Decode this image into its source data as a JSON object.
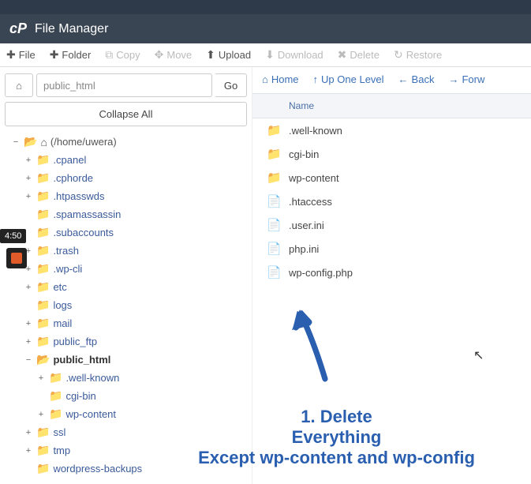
{
  "header": {
    "logo": "cP",
    "title": "File Manager"
  },
  "toolbar": {
    "file": "File",
    "folder": "Folder",
    "copy": "Copy",
    "move": "Move",
    "upload": "Upload",
    "download": "Download",
    "delete": "Delete",
    "restore": "Restore"
  },
  "address": {
    "path": "public_html",
    "go": "Go"
  },
  "collapse_all": "Collapse All",
  "tree": {
    "root": "(/home/uwera)",
    "items": [
      {
        "label": ".cpanel",
        "toggle": "+",
        "icon": "folder",
        "indent": 1
      },
      {
        "label": ".cphorde",
        "toggle": "+",
        "icon": "folder",
        "indent": 1
      },
      {
        "label": ".htpasswds",
        "toggle": "+",
        "icon": "folder",
        "indent": 1
      },
      {
        "label": ".spamassassin",
        "toggle": "",
        "icon": "folder",
        "indent": 1
      },
      {
        "label": ".subaccounts",
        "toggle": "",
        "icon": "folder",
        "indent": 1
      },
      {
        "label": ".trash",
        "toggle": "+",
        "icon": "folder",
        "indent": 1
      },
      {
        "label": ".wp-cli",
        "toggle": "+",
        "icon": "folder",
        "indent": 1
      },
      {
        "label": "etc",
        "toggle": "+",
        "icon": "folder",
        "indent": 1
      },
      {
        "label": "logs",
        "toggle": "",
        "icon": "folder",
        "indent": 1
      },
      {
        "label": "mail",
        "toggle": "+",
        "icon": "folder",
        "indent": 1
      },
      {
        "label": "public_ftp",
        "toggle": "+",
        "icon": "folder",
        "indent": 1
      },
      {
        "label": "public_html",
        "toggle": "−",
        "icon": "folder-open",
        "indent": 1,
        "bold": true
      },
      {
        "label": ".well-known",
        "toggle": "+",
        "icon": "folder",
        "indent": 2
      },
      {
        "label": "cgi-bin",
        "toggle": "",
        "icon": "folder",
        "indent": 2
      },
      {
        "label": "wp-content",
        "toggle": "+",
        "icon": "folder",
        "indent": 2
      },
      {
        "label": "ssl",
        "toggle": "+",
        "icon": "folder",
        "indent": 1
      },
      {
        "label": "tmp",
        "toggle": "+",
        "icon": "folder",
        "indent": 1
      },
      {
        "label": "wordpress-backups",
        "toggle": "",
        "icon": "folder",
        "indent": 1
      }
    ]
  },
  "nav": {
    "home": "Home",
    "up": "Up One Level",
    "back": "Back",
    "forward": "Forw"
  },
  "table": {
    "header_name": "Name",
    "rows": [
      {
        "name": ".well-known",
        "type": "folder"
      },
      {
        "name": "cgi-bin",
        "type": "folder"
      },
      {
        "name": "wp-content",
        "type": "folder"
      },
      {
        "name": ".htaccess",
        "type": "file"
      },
      {
        "name": ".user.ini",
        "type": "file"
      },
      {
        "name": "php.ini",
        "type": "file"
      },
      {
        "name": "wp-config.php",
        "type": "file"
      }
    ]
  },
  "annotation": {
    "line1": "1. Delete",
    "line2": "Everything",
    "line3": "Except wp-content and wp-config"
  },
  "overlay": {
    "time": "4:50"
  }
}
